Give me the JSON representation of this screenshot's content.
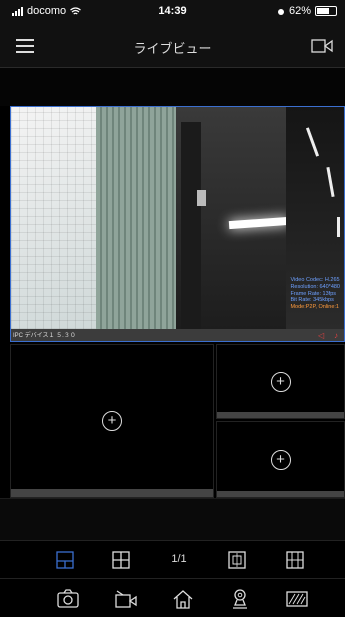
{
  "status": {
    "carrier": "docomo",
    "time": "14:39",
    "battery": "62%"
  },
  "nav": {
    "title": "ライブビュー",
    "menu_icon": "hamburger-menu-icon",
    "record_icon": "video-camera-icon"
  },
  "live": {
    "osd": {
      "codec": "Video Codec: H.265",
      "resolution": "Resolution: 640*480",
      "frame_rate": "Frame Rate: 13fps",
      "bit_rate": "Bit Rate: 345kbps",
      "mode": "Mode:P2P, Online:1"
    },
    "channel_label": "IPC デバイス１ ５.３０",
    "add_symbol": "+"
  },
  "layout_bar": {
    "page": "1/1",
    "icons": [
      "single-view-icon",
      "quad-view-icon",
      "prev-page-icon",
      "next-page-icon"
    ]
  },
  "toolbar": {
    "icons": [
      "snapshot-camera-icon",
      "record-video-icon",
      "home-icon",
      "ptz-icon",
      "stream-quality-icon"
    ]
  },
  "colors": {
    "accent": "#3b6fd0",
    "osd": "#6ea0ff",
    "mode": "#ff9a3c",
    "alert": "#e04040"
  }
}
